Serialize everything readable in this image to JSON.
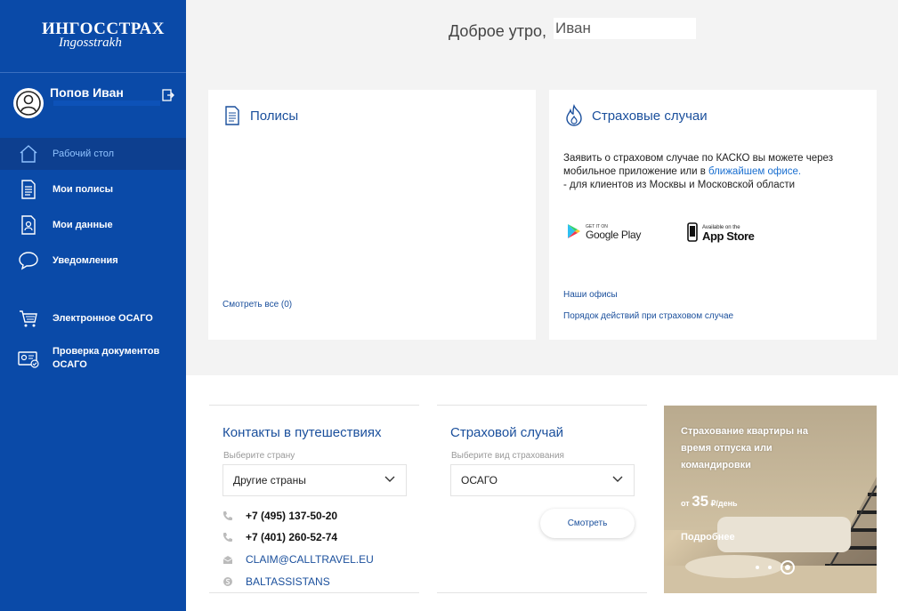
{
  "sidebar": {
    "logo": {
      "line1": "ИНГОССТРАХ",
      "line2": "Ingosstrakh"
    },
    "user": {
      "name": "Попов Иван"
    },
    "nav": [
      {
        "label": "Рабочий стол",
        "icon": "home-icon",
        "active": true
      },
      {
        "label": "Мои полисы",
        "icon": "document-icon"
      },
      {
        "label": "Мои данные",
        "icon": "profile-document-icon"
      },
      {
        "label": "Уведомления",
        "icon": "chat-icon"
      },
      {
        "label": "Электронное ОСАГО",
        "icon": "cart-icon"
      },
      {
        "label": "Проверка документов ОСАГО",
        "icon": "id-card-check-icon"
      }
    ]
  },
  "greeting": {
    "text": "Доброе утро,",
    "name": "Иван"
  },
  "policies": {
    "title": "Полисы",
    "view_all": "Смотреть все (0)"
  },
  "claims": {
    "title": "Страховые случаи",
    "text1": "Заявить о страховом случае по КАСКО вы можете через мобильное приложение или в ",
    "text_link": "ближайшем офисе.",
    "text2": "- для клиентов из Москвы и Московской области",
    "google_play": {
      "small": "GET IT ON",
      "big": "Google Play"
    },
    "app_store": {
      "small": "Available on the",
      "big": "App Store"
    },
    "link_offices": "Наши офисы",
    "link_procedure": "Порядок действий при страховом случае"
  },
  "travel": {
    "title": "Контакты в путешествиях",
    "select_label": "Выберите страну",
    "select_value": "Другие страны",
    "contacts": [
      {
        "icon": "phone-icon",
        "text": "+7 (495) 137-50-20"
      },
      {
        "icon": "phone-icon",
        "text": "+7 (401) 260-52-74"
      },
      {
        "icon": "email-icon",
        "text": "CLAIM@CALLTRAVEL.EU"
      },
      {
        "icon": "skype-icon",
        "text": "BALTASSISTANS"
      }
    ]
  },
  "insurance_case": {
    "title": "Страховой случай",
    "select_label": "Выберите вид страхования",
    "select_value": "ОСАГО",
    "button": "Смотреть"
  },
  "promo": {
    "text": "Страхование квартиры на время отпуска или командировки",
    "price_prefix": "от",
    "price": "35",
    "price_suffix": "₽/день",
    "more": "Подробнее"
  },
  "colors": {
    "sidebar": "#0a4aa8",
    "accent": "#1a4f9c",
    "background": "#f3f3f3"
  }
}
